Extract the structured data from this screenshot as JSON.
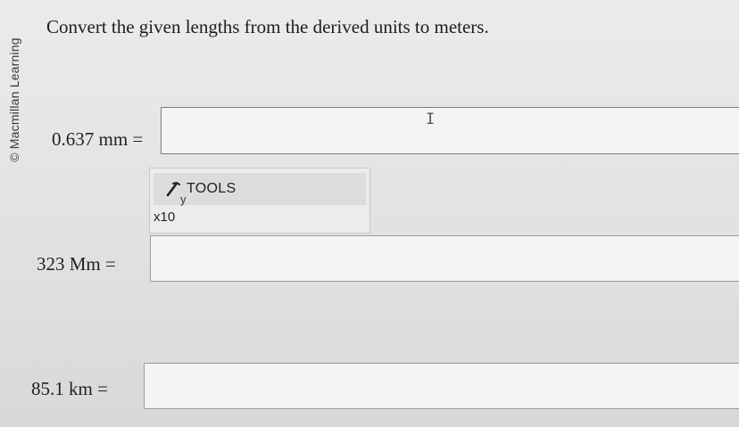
{
  "watermark": "© Macmillan Learning",
  "prompt": "Convert the given lengths from the derived units to meters.",
  "questions": [
    {
      "label": "0.637 mm =",
      "value": ""
    },
    {
      "label": "323 Mm =",
      "value": ""
    },
    {
      "label": "85.1 km =",
      "value": ""
    }
  ],
  "tools": {
    "label": "TOOLS",
    "icon_subscript": "y",
    "multiplier": "x10",
    "icon": "pencil-tools-icon"
  },
  "cursor_icon": "text-cursor-icon"
}
